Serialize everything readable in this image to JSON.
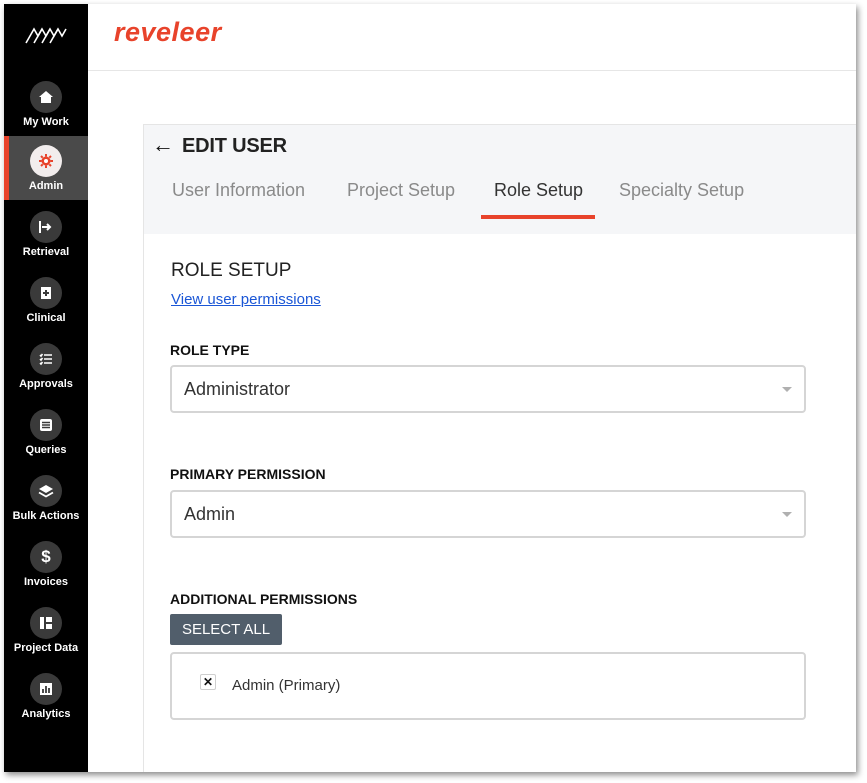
{
  "brand": {
    "name": "reveleer"
  },
  "sidebar": {
    "items": [
      {
        "label": "My Work",
        "icon": "home-icon"
      },
      {
        "label": "Admin",
        "icon": "gear-icon",
        "active": true
      },
      {
        "label": "Retrieval",
        "icon": "arrow-in-icon"
      },
      {
        "label": "Clinical",
        "icon": "clinical-icon"
      },
      {
        "label": "Approvals",
        "icon": "checklist-icon"
      },
      {
        "label": "Queries",
        "icon": "list-icon"
      },
      {
        "label": "Bulk Actions",
        "icon": "layers-icon"
      },
      {
        "label": "Invoices",
        "icon": "dollar-icon"
      },
      {
        "label": "Project Data",
        "icon": "hierarchy-icon"
      },
      {
        "label": "Analytics",
        "icon": "bar-chart-icon"
      }
    ]
  },
  "page": {
    "title": "EDIT USER"
  },
  "tabs": [
    {
      "label": "User Information"
    },
    {
      "label": "Project Setup"
    },
    {
      "label": "Role Setup",
      "active": true
    },
    {
      "label": "Specialty Setup"
    }
  ],
  "role_setup": {
    "title": "ROLE SETUP",
    "permissions_link": "View user permissions",
    "role_type_label": "ROLE TYPE",
    "role_type_value": "Administrator",
    "primary_permission_label": "PRIMARY PERMISSION",
    "primary_permission_value": "Admin",
    "additional_permissions_label": "ADDITIONAL PERMISSIONS",
    "select_all_label": "SELECT ALL",
    "additional_permissions": [
      {
        "label": "Admin (Primary)",
        "checked": true
      }
    ]
  },
  "colors": {
    "accent": "#e8432b",
    "sidebar": "#000000",
    "button": "#515e6b",
    "link": "#1a56d6"
  }
}
